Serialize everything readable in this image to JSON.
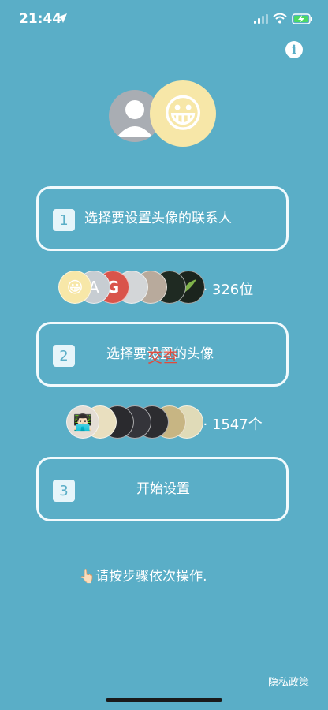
{
  "status_bar": {
    "time": "21:44"
  },
  "hero": {
    "emoji": "😀"
  },
  "steps": [
    {
      "number": "1",
      "label": "选择要设置头像的联系人"
    },
    {
      "number": "2",
      "label": "选择要设置的头像"
    },
    {
      "number": "3",
      "label": "开始设置"
    }
  ],
  "contacts_row": {
    "avatars": [
      "😀",
      "A",
      "G",
      "",
      "",
      ""
    ],
    "count": "··· 326位"
  },
  "avatars_row": {
    "avatars": [
      "👨🏻‍💻",
      "",
      "",
      "",
      "",
      "",
      ""
    ],
    "count": "··· 1547个"
  },
  "overlay_text": "交查",
  "hint": "👆🏻请按步骤依次操作.",
  "privacy_link": "隐私政策",
  "info_icon_label": "i",
  "colors": {
    "background": "#5aaec7",
    "accent_red": "#e24a3b"
  }
}
